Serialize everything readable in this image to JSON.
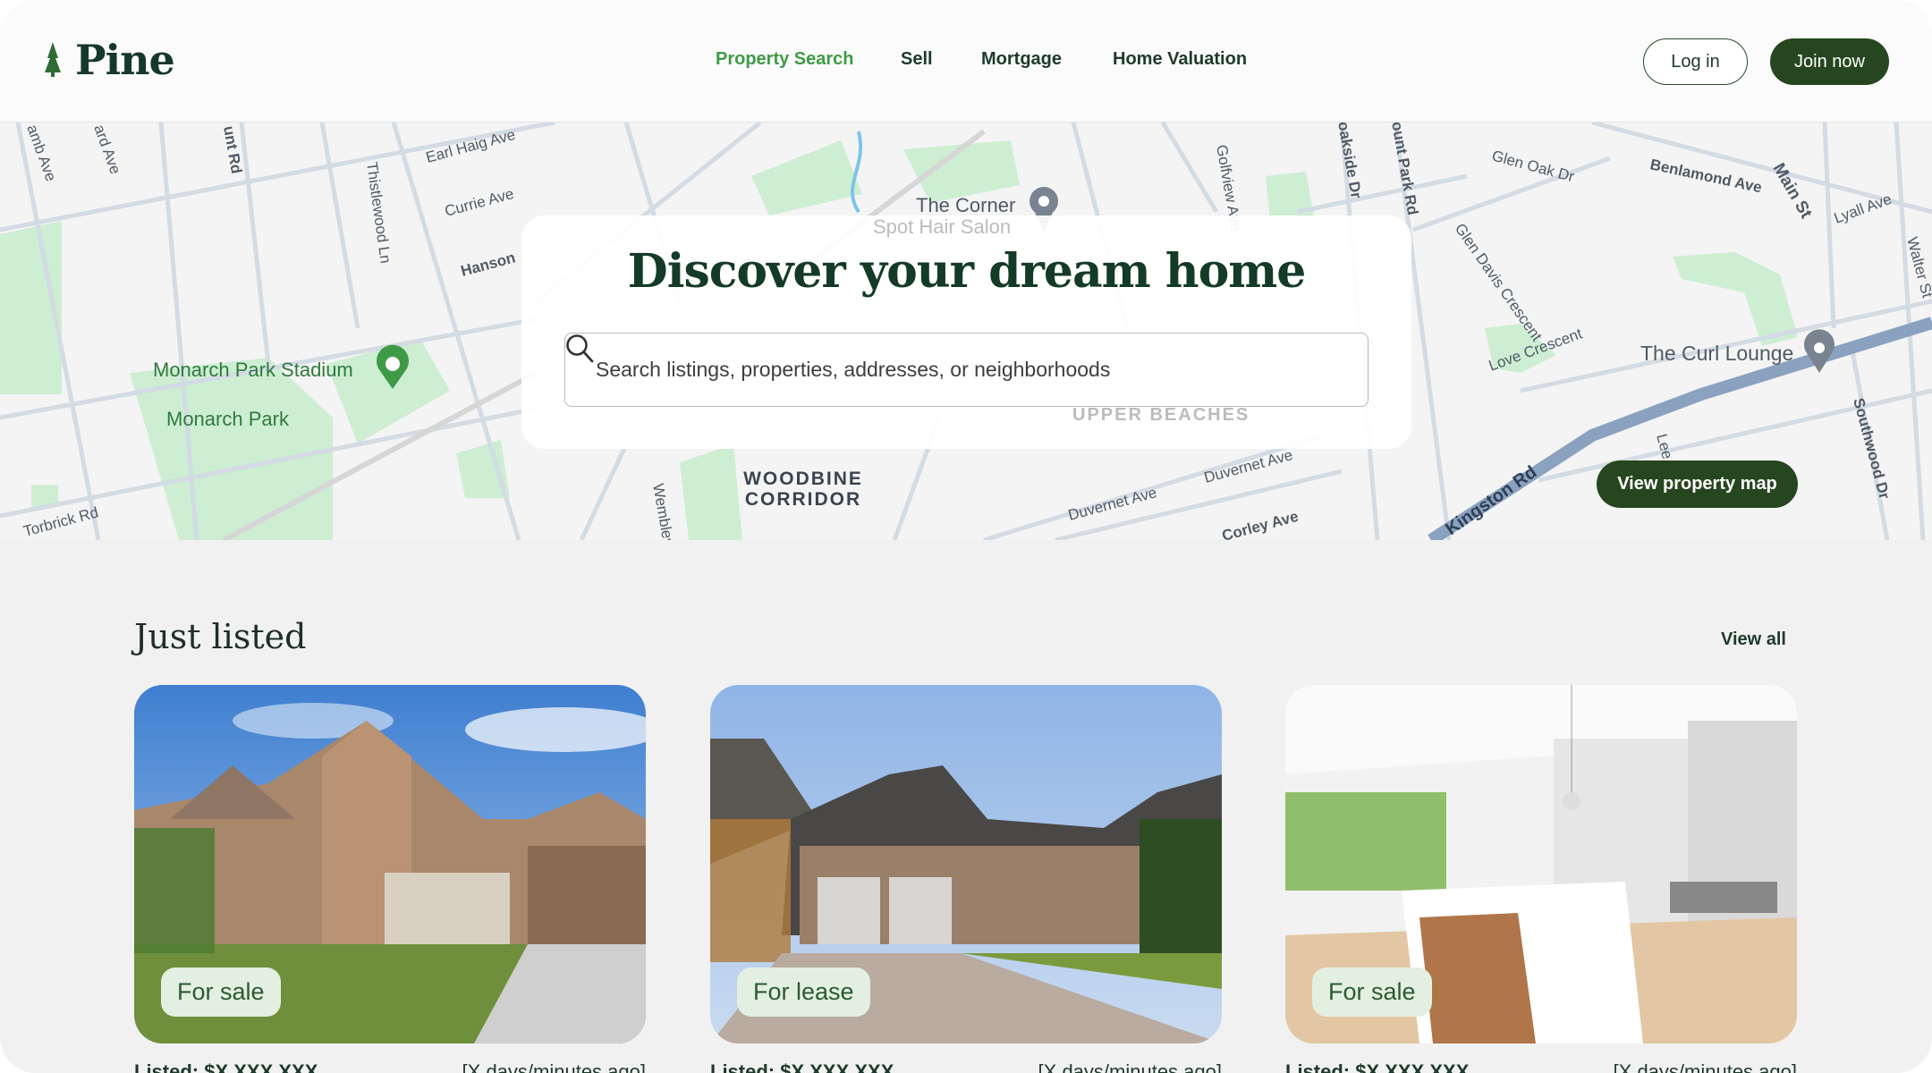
{
  "header": {
    "brand": "Pine",
    "nav": [
      "Property Search",
      "Sell",
      "Mortgage",
      "Home Valuation"
    ],
    "active_nav": "Property Search",
    "login_label": "Log in",
    "join_label": "Join now"
  },
  "hero": {
    "title": "Discover your dream home",
    "search_placeholder": "Search listings, properties, addresses, or neighborhoods",
    "search_value": "",
    "map_button": "View property map"
  },
  "map": {
    "labels": [
      "amb Ave",
      "ard Ave",
      "unt Rd",
      "Earl Haig Ave",
      "Currie Ave",
      "Hanson",
      "Thistlewood Ln",
      "The Corner",
      "Spot Hair Salon",
      "Golfview Ave",
      "oakside Dr",
      "ount Park Rd",
      "Glen Oak Dr",
      "Benlamond Ave",
      "Main St",
      "Lyall Ave",
      "Walter St",
      "Glen Davis Crescent",
      "Love Crescent",
      "The Curl Lounge",
      "Southwood Dr",
      "Kingston Rd",
      "Lee",
      "Monarch Park Stadium",
      "Monarch Park",
      "Torbrick Rd",
      "WOODBINE",
      "CORRIDOR",
      "Duvernet Ave",
      "Duvernet Ave",
      "Corley Ave",
      "Wembley",
      "UPPER BEACHES"
    ]
  },
  "listings": {
    "title": "Just listed",
    "view_all": "View all",
    "cards": [
      {
        "badge": "For sale",
        "price": "Listed: $X,XXX,XXX",
        "time": "[X days/minutes ago]"
      },
      {
        "badge": "For lease",
        "price": "Listed: $X,XXX,XXX",
        "time": "[X days/minutes ago]"
      },
      {
        "badge": "For sale",
        "price": "Listed: $X,XXX,XXX",
        "time": "[X days/minutes ago]"
      }
    ]
  },
  "colors": {
    "brand": "#26461f",
    "accent": "#3f9a45",
    "badge_bg": "#e3efe1",
    "park": "#cdeed3",
    "highway": "#8aa2c0"
  }
}
